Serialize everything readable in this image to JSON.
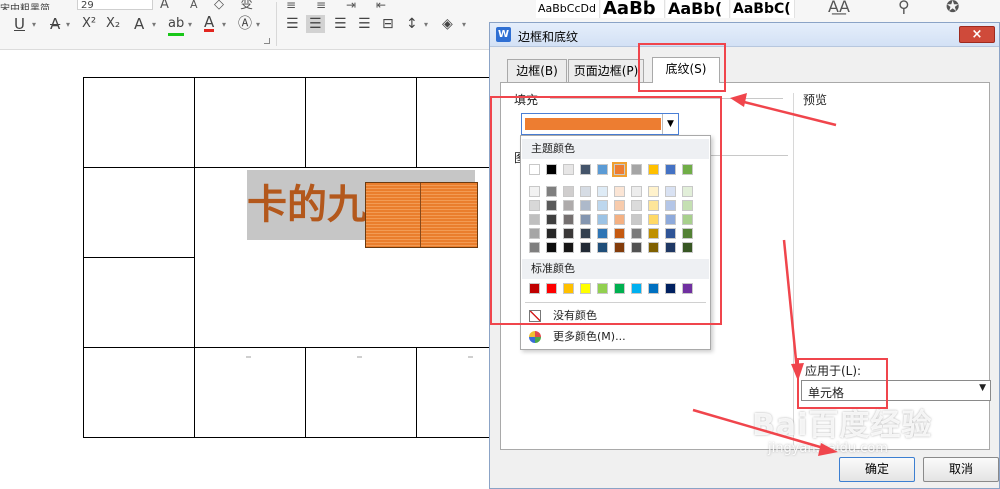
{
  "ribbon": {
    "font_name": "宋中粗黑简",
    "font_size": "29",
    "glyphs": {
      "grow": "A",
      "shrink": "A",
      "clear": "◇",
      "phonetic": "变",
      "underline": "U",
      "strike": "A",
      "superscript": "X²",
      "subscript": "X₂",
      "effect": "A",
      "highlight": "ab",
      "font_color": "A"
    },
    "styles": [
      "AaBbCcDd",
      "AaBb",
      "AaBb(",
      "AaBbC("
    ],
    "right_icons": [
      "text-effects-icon",
      "tool-icon",
      "idea-icon"
    ]
  },
  "document": {
    "title": "卡的九分裤"
  },
  "dialog": {
    "logo": "W",
    "title": "边框和底纹",
    "close": "×",
    "tabs": [
      "边框(B)",
      "页面边框(P)",
      "底纹(S)"
    ],
    "fill_label": "填充",
    "pattern_label": "图",
    "preview_label": "预览",
    "apply_label": "应用于(L):",
    "apply_value": "单元格",
    "ok": "确定",
    "cancel": "取消",
    "fill_color": "#ed7d31"
  },
  "color_popup": {
    "theme_title": "主题颜色",
    "standard_title": "标准颜色",
    "no_color": "没有颜色",
    "more_colors": "更多颜色(M)...",
    "theme_row": [
      "#ffffff",
      "#000000",
      "#e7e6e6",
      "#44546a",
      "#5b9bd5",
      "#ed7d31",
      "#a5a5a5",
      "#ffc000",
      "#4472c4",
      "#70ad47"
    ],
    "shade_rows": [
      [
        "#f2f2f2",
        "#7f7f7f",
        "#d0cece",
        "#d6dce4",
        "#deebf6",
        "#fbe5d5",
        "#ededed",
        "#fff2cc",
        "#d9e2f3",
        "#e2efd9"
      ],
      [
        "#d8d8d8",
        "#595959",
        "#aeabab",
        "#adb9ca",
        "#bdd7ee",
        "#f7cbac",
        "#dbdbdb",
        "#fee599",
        "#b4c6e7",
        "#c5e0b3"
      ],
      [
        "#bfbfbf",
        "#3f3f3f",
        "#757070",
        "#8496b0",
        "#9cc3e5",
        "#f4b183",
        "#c9c9c9",
        "#ffd965",
        "#8eaadb",
        "#a8d08d"
      ],
      [
        "#a5a5a5",
        "#262626",
        "#3a3838",
        "#323f4f",
        "#2e75b5",
        "#c55a11",
        "#7b7b7b",
        "#bf9000",
        "#2f5496",
        "#538135"
      ],
      [
        "#7f7f7f",
        "#0c0c0c",
        "#171616",
        "#222a35",
        "#1f4e79",
        "#833c0b",
        "#525252",
        "#7f6000",
        "#1f3864",
        "#375623"
      ]
    ],
    "standard_row": [
      "#c00000",
      "#ff0000",
      "#ffc000",
      "#ffff00",
      "#92d050",
      "#00b050",
      "#00b0f0",
      "#0070c0",
      "#002060",
      "#7030a0"
    ],
    "selected": "#ed7d31"
  },
  "watermark": {
    "brand": "Bai百度经验",
    "url": "jingyan.baidu.com"
  }
}
